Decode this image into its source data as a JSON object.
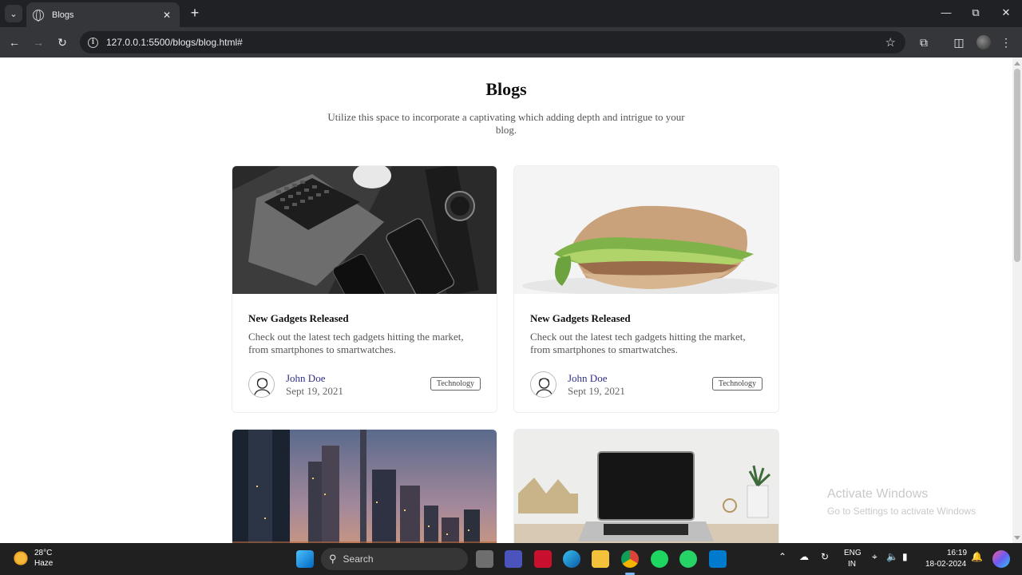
{
  "browser": {
    "tab_title": "Blogs",
    "url": "127.0.0.1:5500/blogs/blog.html#",
    "new_tab_label": "+",
    "tab_close_label": "✕"
  },
  "page": {
    "title": "Blogs",
    "subtitle": "Utilize this space to incorporate a captivating which adding depth and intrigue to your blog."
  },
  "cards": [
    {
      "image": "laptop-phone-watch-dark",
      "title": "New Gadgets Released",
      "text": "Check out the latest tech gadgets hitting the market, from smartphones to smartwatches.",
      "author": "John Doe",
      "date": "Sept 19, 2021",
      "tag": "Technology"
    },
    {
      "image": "sandwich-pita",
      "title": "New Gadgets Released",
      "text": "Check out the latest tech gadgets hitting the market, from smartphones to smartwatches.",
      "author": "John Doe",
      "date": "Sept 19, 2021",
      "tag": "Technology"
    },
    {
      "image": "city-skyline-dusk"
    },
    {
      "image": "laptop-on-desk"
    }
  ],
  "watermark": {
    "line1": "Activate Windows",
    "line2": "Go to Settings to activate Windows"
  },
  "taskbar": {
    "temperature": "28°C",
    "weather": "Haze",
    "search_label": "Search",
    "lang_line1": "ENG",
    "lang_line2": "IN",
    "time": "16:19",
    "date": "18-02-2024"
  }
}
